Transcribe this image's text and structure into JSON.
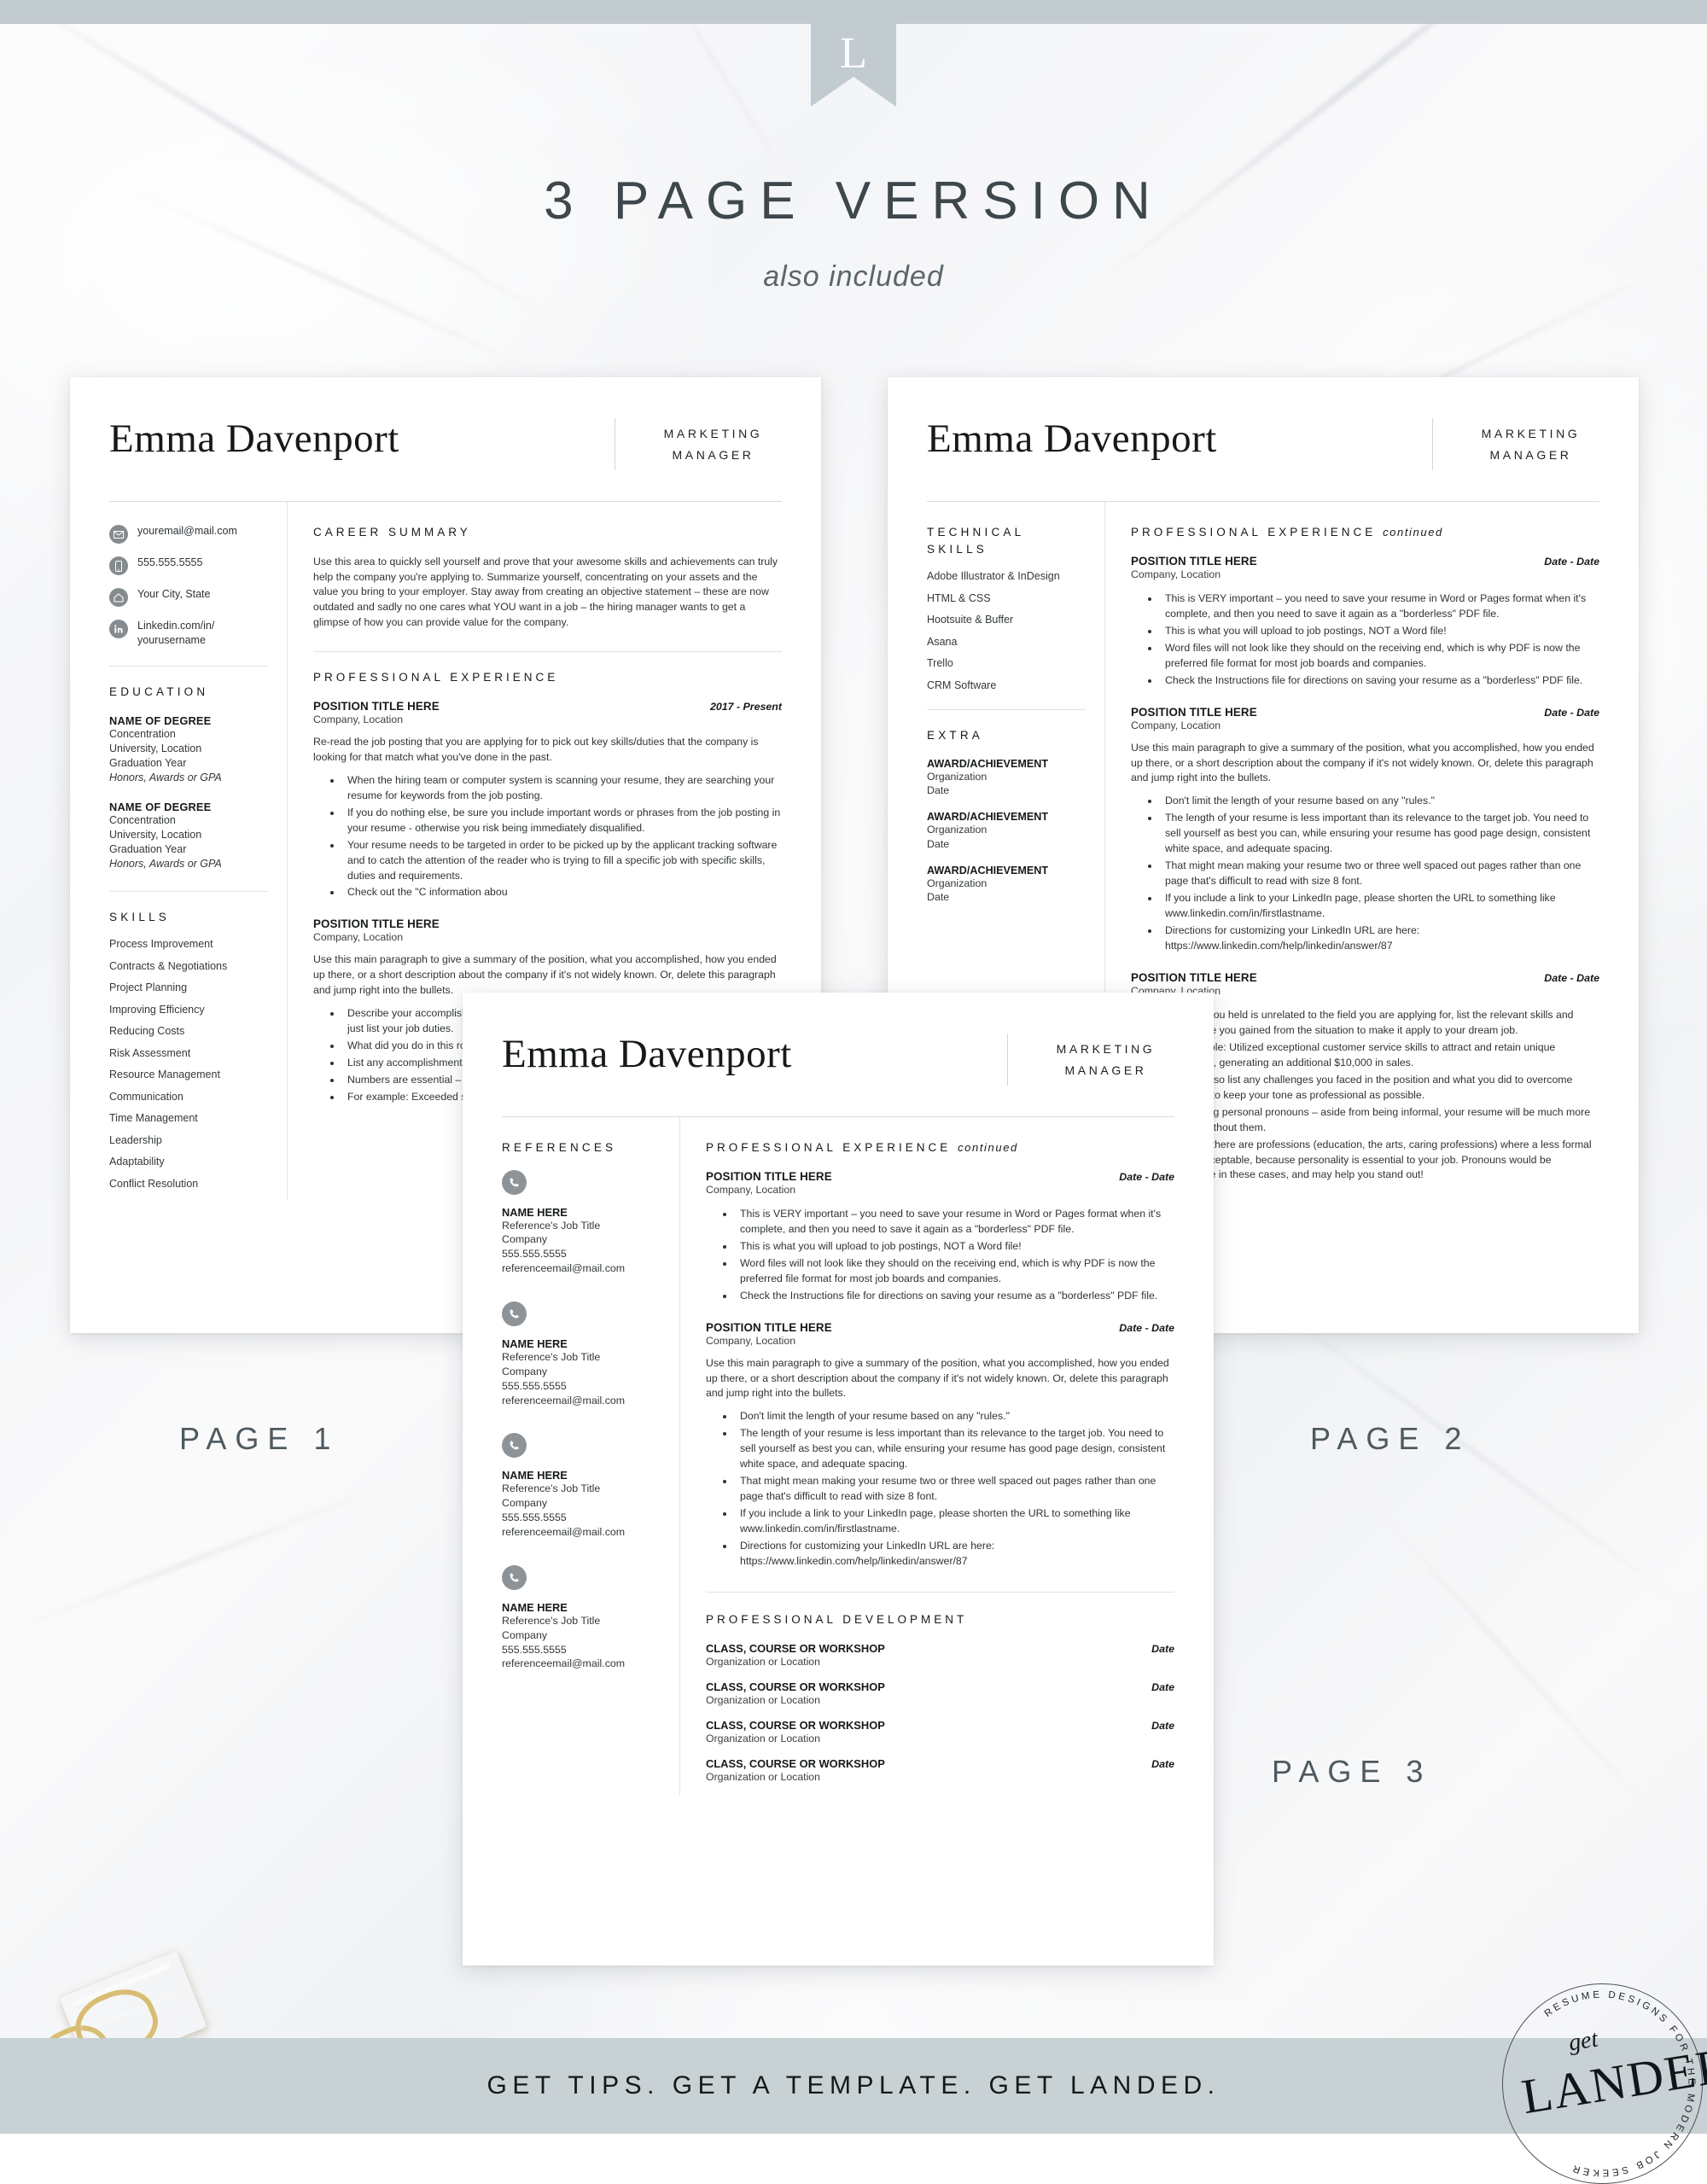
{
  "banner": {
    "logo_letter": "L",
    "title": "3 PAGE VERSION",
    "subtitle": "also included"
  },
  "page_labels": {
    "page1": "PAGE 1",
    "page2": "PAGE 2",
    "page3": "PAGE 3"
  },
  "resume": {
    "name": "Emma Davenport",
    "job_title_line1": "MARKETING",
    "job_title_line2": "MANAGER"
  },
  "page1": {
    "contact": [
      {
        "icon": "envelope-icon",
        "text": "youremail@mail.com"
      },
      {
        "icon": "phone-icon",
        "text": "555.555.5555"
      },
      {
        "icon": "home-icon",
        "text": "Your City, State"
      },
      {
        "icon": "linkedin-icon",
        "text": "Linkedin.com/in/\nyourusername"
      }
    ],
    "education_heading": "EDUCATION",
    "education": [
      {
        "degree": "NAME OF DEGREE",
        "concentration": "Concentration",
        "university": "University, Location",
        "year": "Graduation Year",
        "honors": "Honors, Awards or GPA"
      },
      {
        "degree": "NAME OF DEGREE",
        "concentration": "Concentration",
        "university": "University, Location",
        "year": "Graduation Year",
        "honors": "Honors, Awards or GPA"
      }
    ],
    "skills_heading": "SKILLS",
    "skills": [
      "Process Improvement",
      "Contracts & Negotiations",
      "Project Planning",
      "Improving Efficiency",
      "Reducing Costs",
      "Risk Assessment",
      "Resource Management",
      "Communication",
      "Time Management",
      "Leadership",
      "Adaptability",
      "Conflict Resolution"
    ],
    "summary_heading": "CAREER SUMMARY",
    "summary_text": "Use this area to quickly sell yourself and prove that your awesome skills and achievements can truly help the company you're applying to.  Summarize yourself, concentrating on your assets and the value you bring to your employer. Stay away from creating an objective statement – these are now outdated and sadly no one cares what YOU want in a job – the hiring manager wants to get a glimpse of how you can provide value for the company.",
    "experience_heading": "PROFESSIONAL EXPERIENCE",
    "positions": [
      {
        "title": "POSITION TITLE HERE",
        "date": "2017 - Present",
        "company": "Company, Location",
        "paragraph": "Re-read the job posting that you are applying for to pick out key skills/duties that the company is looking for that match what you've done in the past.",
        "bullets": [
          "When the hiring team or computer system is scanning your resume, they are searching your resume for keywords from the job posting.",
          "If you do nothing else, be sure you include important words or phrases from the job posting in your resume - otherwise you risk being immediately disqualified.",
          "Your resume needs to be targeted in order to be picked up by the applicant tracking software and to catch the attention of the reader who is trying to fill a specific job with specific skills, duties and requirements.",
          "Check out the \"C                                         information abou"
        ]
      },
      {
        "title": "POSITION TITLE HERE",
        "date": "",
        "company": "Company, Location",
        "paragraph": "Use this main paragraph to give a summary of the position, what you accomplished, how you ended up there, or a short description about the company if it's not widely known. Or, delete this paragraph and jump right into the bullets.",
        "bullets": [
          "Describe your accomplishments with action verbs like \"managed\" and \"streamlined\" – don't just list your job duties.",
          "What did you do in this role and what did you contribute to in terms of management?",
          "List any accomplishments, especially ones that have specific numbers attached.",
          "Numbers are essential – if you need to, do a little math to get numbers.",
          "For example: Exceeded sales goals set by the manager."
        ]
      }
    ]
  },
  "page2": {
    "tech_skills_heading_line1": "TECHNICAL",
    "tech_skills_heading_line2": "SKILLS",
    "tech_skills": [
      "Adobe Illustrator & InDesign",
      "HTML & CSS",
      "Hootsuite & Buffer",
      "Asana",
      "Trello",
      "CRM Software"
    ],
    "extra_heading": "EXTRA",
    "awards": [
      {
        "name": "AWARD/ACHIEVEMENT",
        "org": "Organization",
        "date": "Date"
      },
      {
        "name": "AWARD/ACHIEVEMENT",
        "org": "Organization",
        "date": "Date"
      },
      {
        "name": "AWARD/ACHIEVEMENT",
        "org": "Organization",
        "date": "Date"
      }
    ],
    "experience_heading": "PROFESSIONAL EXPERIENCE",
    "experience_heading_suffix": "continued",
    "positions": [
      {
        "title": "POSITION TITLE HERE",
        "date": "Date - Date",
        "company": "Company, Location",
        "paragraph": "",
        "bullets": [
          "This is VERY important – you need to save your resume in Word or Pages format when it's complete, and then you need to save it again as a \"borderless\" PDF file.",
          "This is what you will upload to job postings, NOT a Word file!",
          "Word files will not look like they should on the receiving end, which is why PDF is now the preferred file format for most job boards and companies.",
          "Check the Instructions file for directions on saving your resume as a \"borderless\" PDF file."
        ]
      },
      {
        "title": "POSITION TITLE HERE",
        "date": "Date - Date",
        "company": "Company, Location",
        "paragraph": "Use this main paragraph to give a summary of the position, what you accomplished, how you ended up there, or a short description about the company if it's not widely known. Or, delete this paragraph and jump right into the bullets.",
        "bullets": [
          "Don't limit the length of your resume based on any \"rules.\"",
          "The length of your resume is less important than its relevance to the target job. You need to sell yourself as best you can, while ensuring your resume has good page design, consistent white space, and adequate spacing.",
          "That might mean making your resume two or three well spaced out pages rather than one page that's difficult to read with size 8 font.",
          "If you include a link to your LinkedIn page, please shorten the URL to something like www.linkedin.com/in/firstlastname.",
          "Directions for customizing your LinkedIn URL are here: https://www.linkedin.com/help/linkedin/answer/87"
        ]
      },
      {
        "title": "POSITION TITLE HERE",
        "date": "Date - Date",
        "company": "Company, Location",
        "paragraph": "",
        "bullets": [
          "If the job you held is unrelated to the field you are applying for, list the relevant skills and experience you gained from the situation to make it apply to your dream job.",
          "For example:  Utilized exceptional customer service skills to attract and retain unique customers, generating an additional $10,000 in sales.",
          "You can also list any challenges you faced in the position and what you did to overcome them. Try to keep your tone as professional as possible.",
          "Avoid using personal pronouns – aside from being informal, your resume will be much more concise without them.",
          "However, there are professions (education, the arts, caring professions) where a less formal tone is acceptable, because personality is essential to your job. Pronouns would be acceptable in these cases, and may help you stand out!"
        ]
      }
    ]
  },
  "page3": {
    "references_heading": "REFERENCES",
    "references": [
      {
        "icon": "phone-icon",
        "name": "NAME HERE",
        "job_title": "Reference's Job Title",
        "company": "Company",
        "phone": "555.555.5555",
        "email": "referenceemail@mail.com"
      },
      {
        "icon": "phone-icon",
        "name": "NAME HERE",
        "job_title": "Reference's Job Title",
        "company": "Company",
        "phone": "555.555.5555",
        "email": "referenceemail@mail.com"
      },
      {
        "icon": "phone-icon",
        "name": "NAME HERE",
        "job_title": "Reference's Job Title",
        "company": "Company",
        "phone": "555.555.5555",
        "email": "referenceemail@mail.com"
      },
      {
        "icon": "phone-icon",
        "name": "NAME HERE",
        "job_title": "Reference's Job Title",
        "company": "Company",
        "phone": "555.555.5555",
        "email": "referenceemail@mail.com"
      }
    ],
    "experience_heading": "PROFESSIONAL EXPERIENCE",
    "experience_heading_suffix": "continued",
    "positions": [
      {
        "title": "POSITION TITLE HERE",
        "date": "Date - Date",
        "company": "Company, Location",
        "paragraph": "",
        "bullets": [
          "This is VERY important – you need to save your resume in Word or Pages format when it's complete, and then you need to save it again as a \"borderless\" PDF file.",
          "This is what you will upload to job postings, NOT a Word file!",
          "Word files will not look like they should on the receiving end, which is why PDF is now the preferred file format for most job boards and companies.",
          "Check the Instructions file for directions on saving your resume as a \"borderless\" PDF file."
        ]
      },
      {
        "title": "POSITION TITLE HERE",
        "date": "Date - Date",
        "company": "Company, Location",
        "paragraph": "Use this main paragraph to give a summary of the position, what you accomplished, how you ended up there, or a short description about the company if it's not widely known. Or, delete this paragraph and jump right into the bullets.",
        "bullets": [
          "Don't limit the length of your resume based on any \"rules.\"",
          "The length of your resume is less important than its relevance to the target job. You need to sell yourself as best you can, while ensuring your resume has good page design, consistent white space, and adequate spacing.",
          "That might mean making your resume two or three well spaced out pages rather than one page that's difficult to read with size 8 font.",
          "If you include a link to your LinkedIn page, please shorten the URL to something like www.linkedin.com/in/firstlastname.",
          "Directions for customizing your LinkedIn URL are here: https://www.linkedin.com/help/linkedin/answer/87"
        ]
      }
    ],
    "development_heading": "PROFESSIONAL DEVELOPMENT",
    "development": [
      {
        "name": "CLASS, COURSE OR WORKSHOP",
        "org": "Organization or Location",
        "date": "Date"
      },
      {
        "name": "CLASS, COURSE OR WORKSHOP",
        "org": "Organization or Location",
        "date": "Date"
      },
      {
        "name": "CLASS, COURSE OR WORKSHOP",
        "org": "Organization or Location",
        "date": "Date"
      },
      {
        "name": "CLASS, COURSE OR WORKSHOP",
        "org": "Organization or Location",
        "date": "Date"
      }
    ]
  },
  "footer": {
    "tagline": "GET TIPS. GET A TEMPLATE. GET LANDED."
  },
  "badge": {
    "ring_text": "RESUME DESIGNS FOR THE MODERN JOB SEEKER",
    "get": "get",
    "landed": "LANDED"
  },
  "colors": {
    "banner": "#c2cbd0",
    "footer": "#c8d1d4",
    "title_text": "#3d474c",
    "icon_gray": "#858b8f",
    "rule": "#d8dbde"
  }
}
